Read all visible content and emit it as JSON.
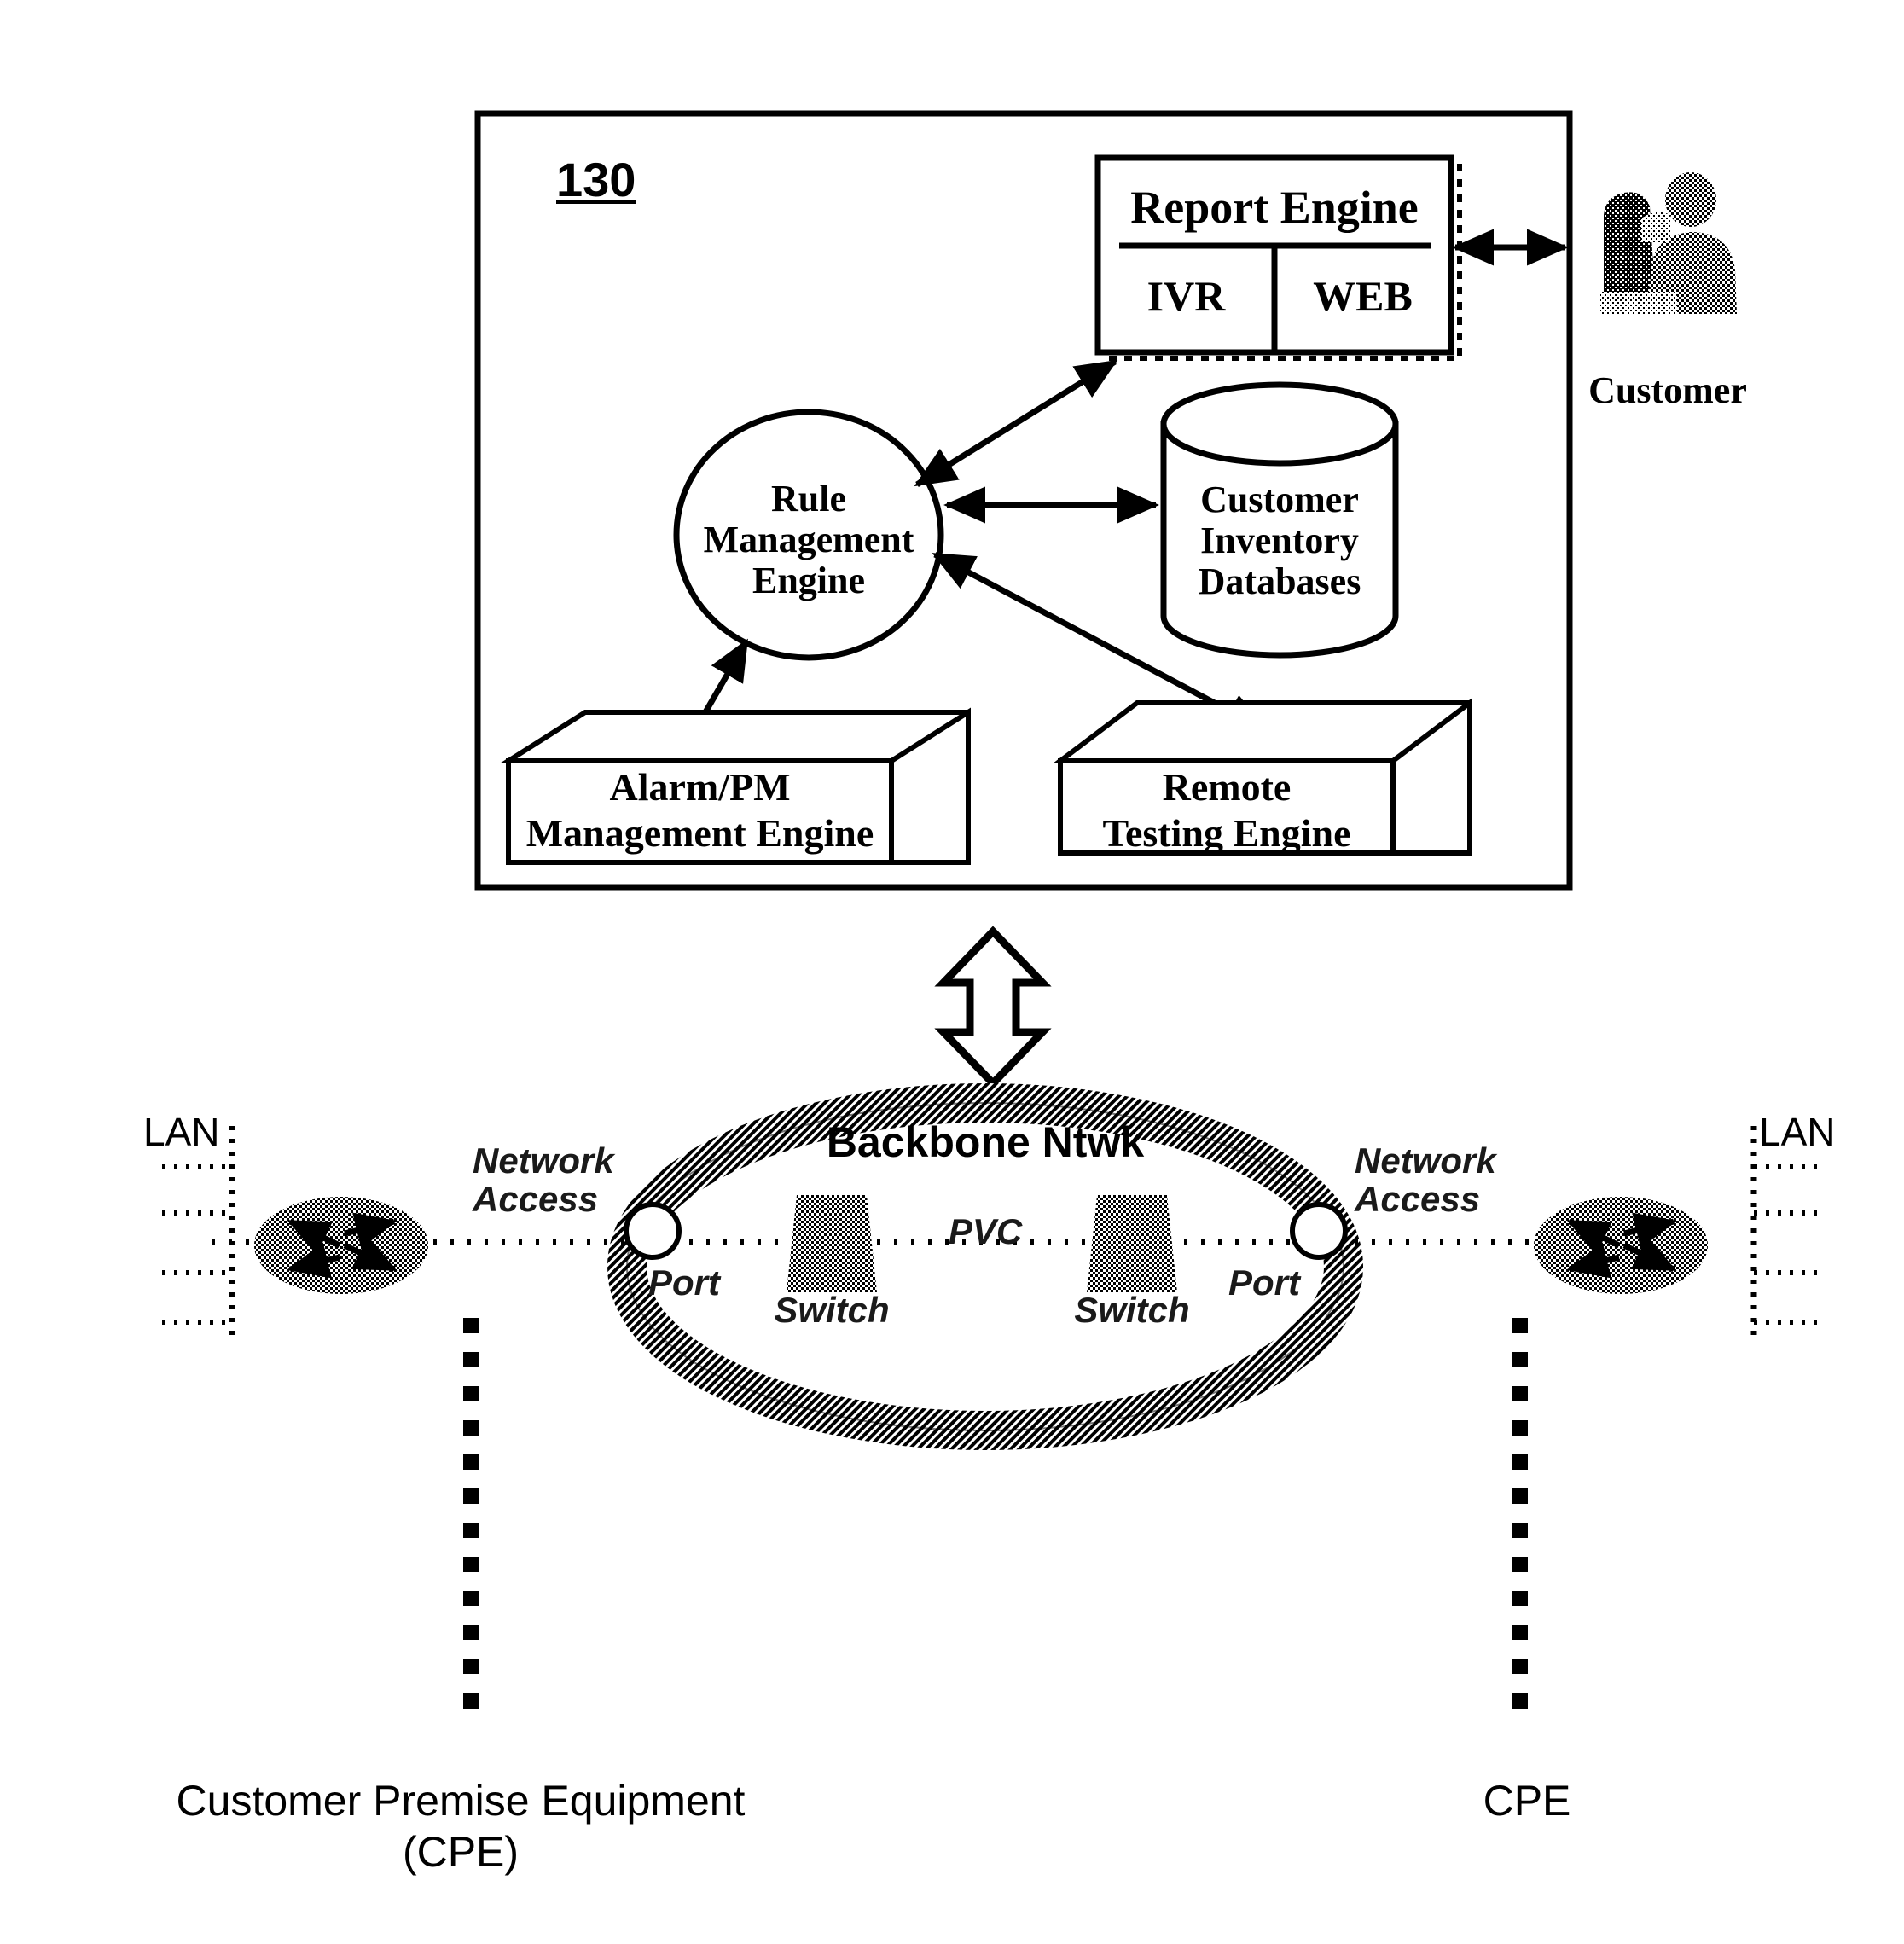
{
  "figure": {
    "reference_numeral": "130"
  },
  "management_system": {
    "report_engine": {
      "title": "Report Engine",
      "cells": [
        "IVR",
        "WEB"
      ]
    },
    "rule_engine": {
      "lines": [
        "Rule",
        "Management",
        "Engine"
      ]
    },
    "database": {
      "lines": [
        "Customer",
        "Inventory",
        "Databases"
      ]
    },
    "alarm_engine": {
      "lines": [
        "Alarm/PM",
        "Management Engine"
      ]
    },
    "remote_testing_engine": {
      "lines": [
        "Remote",
        "Testing Engine"
      ]
    },
    "customer": {
      "label": "Customer"
    }
  },
  "network": {
    "backbone": {
      "title": "Backbone Ntwk",
      "pvc_label": "PVC",
      "port_left_label": "Port",
      "port_right_label": "Port",
      "switch_left_label": "Switch",
      "switch_right_label": "Switch"
    },
    "left_side": {
      "lan_label": "LAN",
      "access_line1": "Network",
      "access_line2": "Access",
      "cpe_caption_line1": "Customer Premise Equipment",
      "cpe_caption_line2": "(CPE)"
    },
    "right_side": {
      "lan_label": "LAN",
      "access_line1": "Network",
      "access_line2": "Access",
      "cpe_caption": "CPE"
    }
  },
  "colors": {
    "ink": "#000000",
    "paper": "#ffffff",
    "dither": "#8a8a8a",
    "dither_light": "#b5b5b5"
  }
}
